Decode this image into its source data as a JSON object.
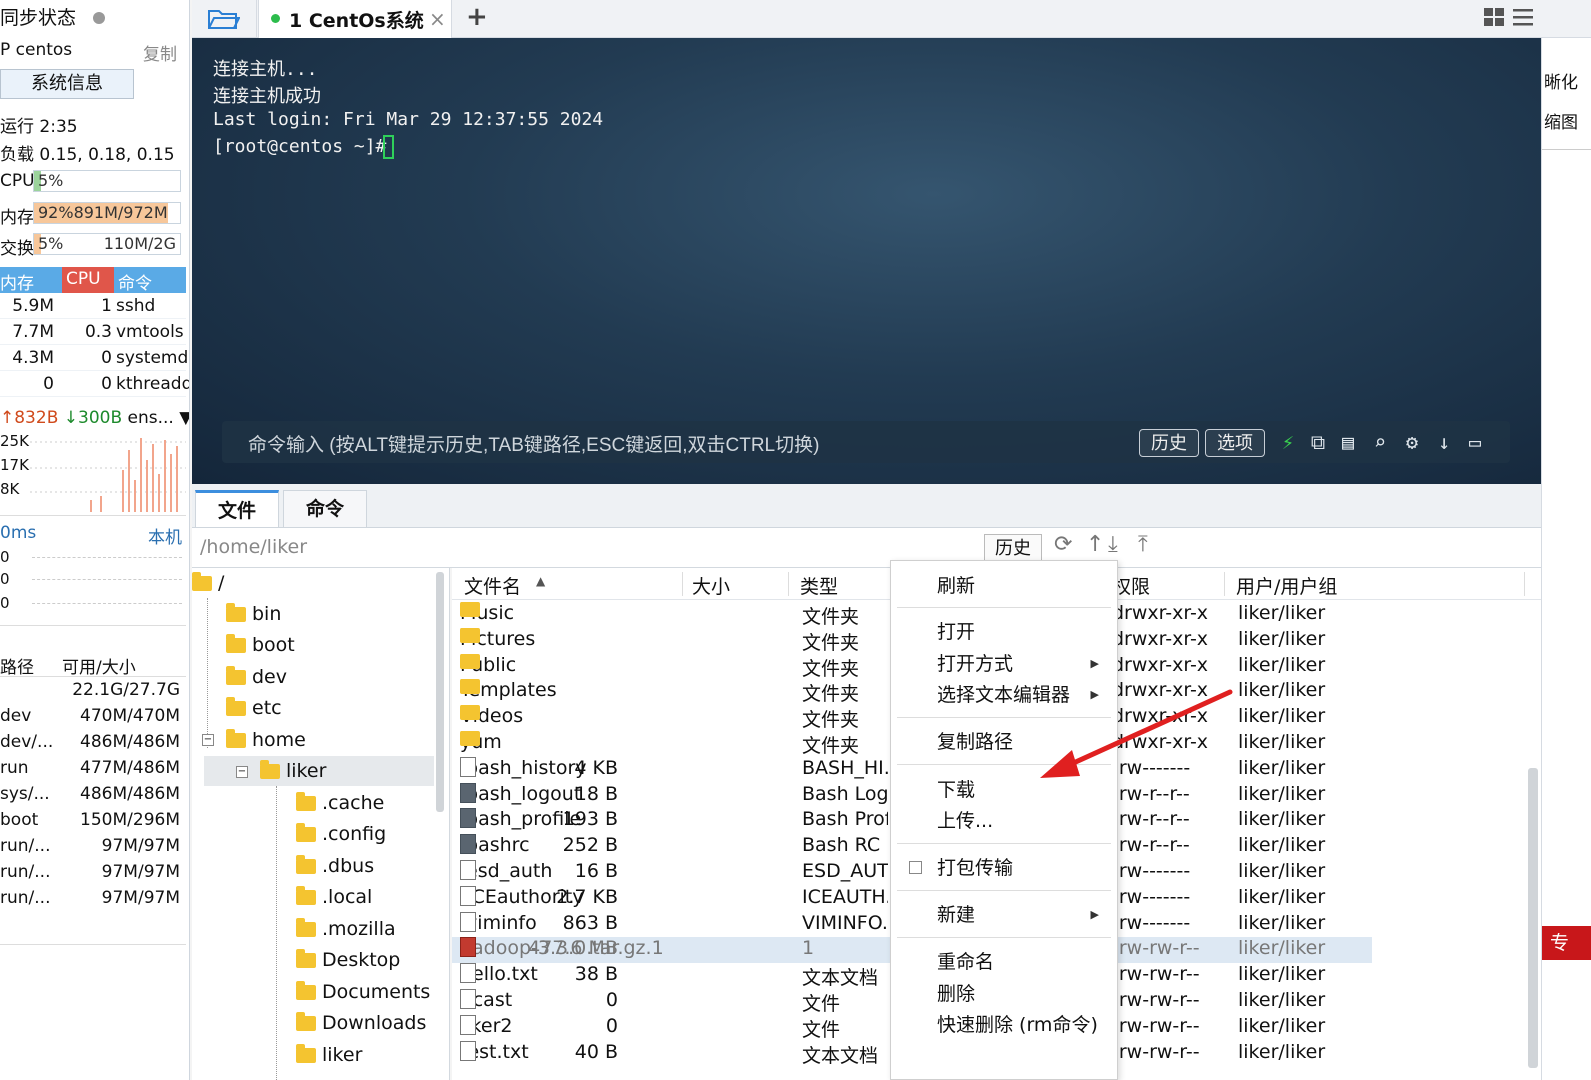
{
  "left": {
    "sync_status": "同步状态",
    "ip_label": "P centos",
    "copy_label": "复制",
    "sysinfo_button": "系统信息",
    "uptime": "运行 2:35",
    "load": "负载 0.15, 0.18, 0.15",
    "cpu_label": "CPU",
    "cpu_value": "5%",
    "mem_label": "内存",
    "mem_value": "92%891M/972M",
    "swap_label": "交换",
    "swap_value": "5%",
    "swap_size": "110M/2G",
    "proc_headers": [
      "内存",
      "CPU",
      "命令"
    ],
    "processes": [
      {
        "mem": "5.9M",
        "cpu": "1",
        "cmd": "sshd"
      },
      {
        "mem": "7.7M",
        "cpu": "0.3",
        "cmd": "vmtools"
      },
      {
        "mem": "4.3M",
        "cpu": "0",
        "cmd": "systemd"
      },
      {
        "mem": "0",
        "cpu": "0",
        "cmd": "kthreadd"
      }
    ],
    "net_up": "↑832B",
    "net_down": "↓300B",
    "net_iface": "ens...",
    "net_axis": [
      "25K",
      "17K",
      "8K"
    ],
    "ping_label": "0ms",
    "ping_host": "本机",
    "ping_axis": [
      "0",
      "0",
      "0"
    ],
    "disk_headers": [
      "路径",
      "可用/大小"
    ],
    "disks": [
      {
        "path": "",
        "size": "22.1G/27.7G"
      },
      {
        "path": "dev",
        "size": "470M/470M"
      },
      {
        "path": "dev/...",
        "size": "486M/486M"
      },
      {
        "path": "run",
        "size": "477M/486M"
      },
      {
        "path": "sys/...",
        "size": "486M/486M"
      },
      {
        "path": "boot",
        "size": "150M/296M"
      },
      {
        "path": "run/...",
        "size": "97M/97M"
      },
      {
        "path": "run/...",
        "size": "97M/97M"
      },
      {
        "path": "run/...",
        "size": "97M/97M"
      }
    ]
  },
  "topbar": {
    "tab_title": "1 CentOs系统",
    "close": "×",
    "add": "+"
  },
  "terminal": {
    "lines": [
      "连接主机...",
      "连接主机成功",
      "Last login: Fri Mar 29 12:37:55 2024",
      "[root@centos ~]# "
    ],
    "cmd_placeholder": "命令输入 (按ALT键提示历史,TAB键路径,ESC键返回,双击CTRL切换)",
    "history_button": "历史",
    "options_button": "选项"
  },
  "bottom": {
    "tab_files": "文件",
    "tab_commands": "命令",
    "path": "/home/liker",
    "history_button": "历史"
  },
  "tree": {
    "root": "/",
    "items": [
      "bin",
      "boot",
      "dev",
      "etc",
      "home",
      "liker",
      ".cache",
      ".config",
      ".dbus",
      ".local",
      ".mozilla",
      "Desktop",
      "Documents",
      "Downloads",
      "liker"
    ]
  },
  "files": {
    "headers": {
      "name": "文件名",
      "size": "大小",
      "type": "类型",
      "perm": "权限",
      "owner": "用户/用户组"
    },
    "rows": [
      {
        "name": "Music",
        "size": "",
        "type": "文件夹",
        "perm": "drwxr-xr-x",
        "owner": "liker/liker",
        "icon": "folder"
      },
      {
        "name": "Pictures",
        "size": "",
        "type": "文件夹",
        "perm": "drwxr-xr-x",
        "owner": "liker/liker",
        "icon": "folder"
      },
      {
        "name": "Public",
        "size": "",
        "type": "文件夹",
        "perm": "drwxr-xr-x",
        "owner": "liker/liker",
        "icon": "folder"
      },
      {
        "name": "Templates",
        "size": "",
        "type": "文件夹",
        "perm": "drwxr-xr-x",
        "owner": "liker/liker",
        "icon": "folder"
      },
      {
        "name": "Videos",
        "size": "",
        "type": "文件夹",
        "perm": "drwxr-xr-x",
        "owner": "liker/liker",
        "icon": "folder"
      },
      {
        "name": "yum",
        "size": "",
        "type": "文件夹",
        "perm": "drwxr-xr-x",
        "owner": "liker/liker",
        "icon": "folder"
      },
      {
        "name": ".bash_history",
        "size": "4 KB",
        "type": "BASH_HI...",
        "perm": "-rw-------",
        "owner": "liker/liker",
        "icon": "file"
      },
      {
        "name": ".bash_logout",
        "size": "18 B",
        "type": "Bash Log...",
        "perm": "-rw-r--r--",
        "owner": "liker/liker",
        "icon": "dark"
      },
      {
        "name": ".bash_profile",
        "size": "193 B",
        "type": "Bash Prof...",
        "perm": "-rw-r--r--",
        "owner": "liker/liker",
        "icon": "dark"
      },
      {
        "name": ".bashrc",
        "size": "252 B",
        "type": "Bash RC ...",
        "perm": "-rw-r--r--",
        "owner": "liker/liker",
        "icon": "dark"
      },
      {
        "name": ".esd_auth",
        "size": "16 B",
        "type": "ESD_AUT...",
        "perm": "-rw-------",
        "owner": "liker/liker",
        "icon": "file"
      },
      {
        "name": ".ICEauthority",
        "size": "2.7 KB",
        "type": "ICEAUTH...",
        "perm": "-rw-------",
        "owner": "liker/liker",
        "icon": "file"
      },
      {
        "name": ".viminfo",
        "size": "863 B",
        "type": "VIMINFO...",
        "perm": "-rw-------",
        "owner": "liker/liker",
        "icon": "file"
      },
      {
        "name": "hadoop-3.3.0.tar.gz.1",
        "size": "477.6 MB",
        "type": "1",
        "perm": "-rw-rw-r--",
        "owner": "liker/liker",
        "icon": "red"
      },
      {
        "name": "hello.txt",
        "size": "38 B",
        "type": "文本文档",
        "perm": "-rw-rw-r--",
        "owner": "liker/liker",
        "icon": "file"
      },
      {
        "name": "itcast",
        "size": "0",
        "type": "文件",
        "perm": "-rw-rw-r--",
        "owner": "liker/liker",
        "icon": "file"
      },
      {
        "name": "liker2",
        "size": "0",
        "type": "文件",
        "perm": "-rw-rw-r--",
        "owner": "liker/liker",
        "icon": "file"
      },
      {
        "name": "test.txt",
        "size": "40 B",
        "type": "文本文档",
        "perm": "-rw-rw-r--",
        "owner": "liker/liker",
        "icon": "file"
      }
    ]
  },
  "menu": {
    "refresh": "刷新",
    "open": "打开",
    "open_with": "打开方式",
    "choose_editor": "选择文本编辑器",
    "copy_path": "复制路径",
    "download": "下载",
    "upload": "上传...",
    "pack_transfer": "打包传输",
    "new": "新建",
    "rename": "重命名",
    "delete": "删除",
    "quick_delete": "快速删除 (rm命令)"
  },
  "right_edge": {
    "text1": "晰化",
    "text2": "缩图",
    "badge": "专"
  },
  "colors": {
    "accent": "#5aaae6",
    "terminal_bg": "#223b52",
    "arrow": "#e02020",
    "selected_row": "#dde8f3"
  }
}
